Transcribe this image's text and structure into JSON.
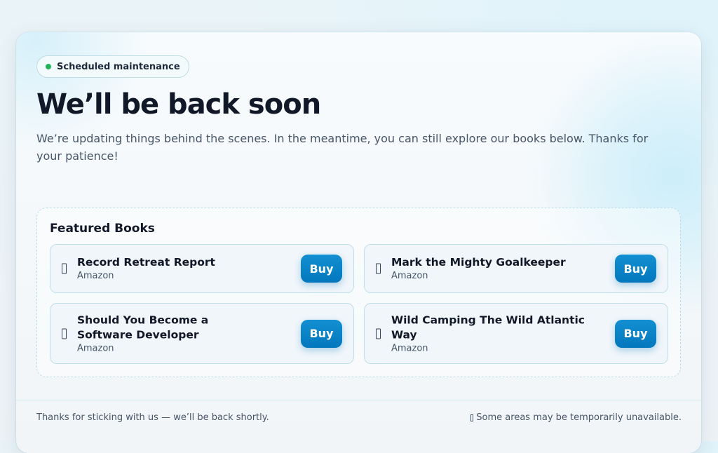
{
  "status_badge": {
    "label": "Scheduled maintenance",
    "color": "#22b35a"
  },
  "hero": {
    "title": "We’ll be back soon",
    "subtitle": "We’re updating things behind the scenes. In the meantime, you can still explore our books below. Thanks for your patience!"
  },
  "featured": {
    "heading": "Featured Books",
    "books": [
      {
        "title": "Record Retreat Report",
        "source": "Amazon",
        "buy_label": "Buy",
        "icon": "book-icon"
      },
      {
        "title": "Mark the Mighty Goalkeeper",
        "source": "Amazon",
        "buy_label": "Buy",
        "icon": "book-icon"
      },
      {
        "title": "Should You Become a Software Developer",
        "source": "Amazon",
        "buy_label": "Buy",
        "icon": "book-icon"
      },
      {
        "title": "Wild Camping The Wild Atlantic Way",
        "source": "Amazon",
        "buy_label": "Buy",
        "icon": "book-icon"
      }
    ]
  },
  "footer": {
    "left_text": "Thanks for sticking with us — we’ll be back shortly.",
    "right_text": "Some areas may be temporarily unavailable.",
    "right_icon": "info-icon"
  },
  "colors": {
    "accent": "#0277bd",
    "heading": "#111827",
    "body_text": "#475569"
  }
}
